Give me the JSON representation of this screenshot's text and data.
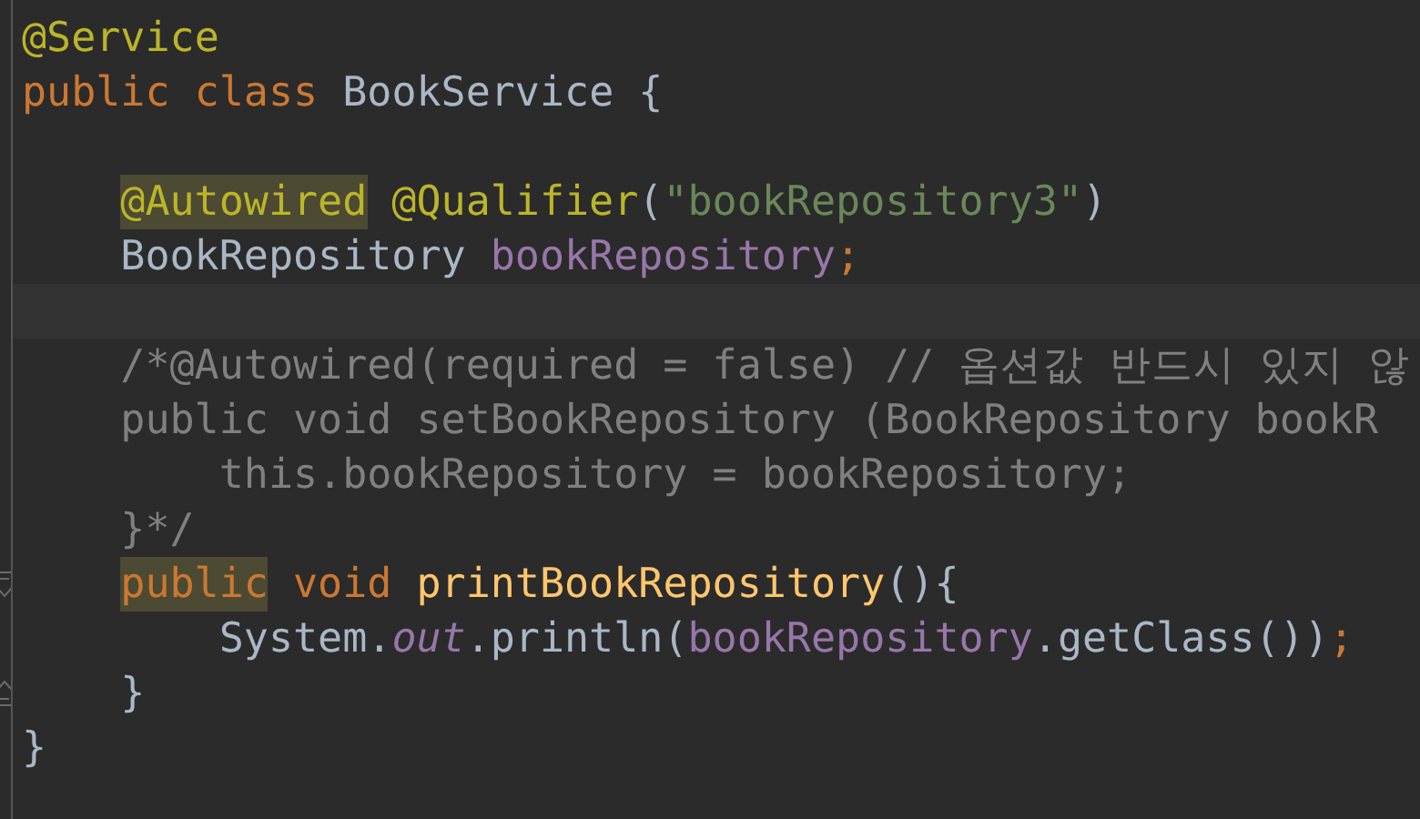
{
  "editor": {
    "lines": [
      {
        "kind": "code",
        "tokens": [
          {
            "kind": "annotation",
            "text": "@Service"
          }
        ]
      },
      {
        "kind": "code",
        "tokens": [
          {
            "kind": "keyword",
            "text": "public class "
          },
          {
            "kind": "plain",
            "text": "BookService {"
          }
        ],
        "children": [
          {
            "kind": "blank"
          },
          {
            "kind": "code",
            "tokens": [
              {
                "kind": "annotation",
                "text": "@Autowired",
                "highlighted": true
              },
              {
                "kind": "annotation",
                "text": " @Qualifier"
              },
              {
                "kind": "plain",
                "text": "("
              },
              {
                "kind": "string",
                "text": "\"bookRepository3\""
              },
              {
                "kind": "plain",
                "text": ")"
              }
            ]
          },
          {
            "kind": "code",
            "tokens": [
              {
                "kind": "plain",
                "text": "BookRepository "
              },
              {
                "kind": "field",
                "text": "bookRepository"
              },
              {
                "kind": "keyword",
                "text": ";"
              }
            ]
          },
          {
            "kind": "blank",
            "current": true
          },
          {
            "kind": "code",
            "tokens": [
              {
                "kind": "comment",
                "text": "/*@Autowired(required = false) // 옵션값 반드시 있지 않"
              }
            ]
          },
          {
            "kind": "code",
            "tokens": [
              {
                "kind": "comment",
                "text": "public void setBookRepository (BookRepository bookR"
              }
            ]
          },
          {
            "kind": "code",
            "tokens": [
              {
                "kind": "comment",
                "text": "    this.bookRepository = bookRepository;"
              }
            ]
          },
          {
            "kind": "code",
            "tokens": [
              {
                "kind": "comment",
                "text": "}*/"
              }
            ]
          },
          {
            "kind": "code",
            "expanded": true,
            "tokens": [
              {
                "kind": "keyword",
                "text": "public",
                "highlighted": true
              },
              {
                "kind": "keyword",
                "text": " void "
              },
              {
                "kind": "method",
                "text": "printBookRepository"
              },
              {
                "kind": "plain",
                "text": "(){"
              }
            ],
            "children": [
              {
                "kind": "code",
                "tokens": [
                  {
                    "kind": "plain",
                    "text": "System."
                  },
                  {
                    "kind": "static",
                    "text": "out"
                  },
                  {
                    "kind": "plain",
                    "text": ".println("
                  },
                  {
                    "kind": "field",
                    "text": "bookRepository"
                  },
                  {
                    "kind": "plain",
                    "text": ".getClass())"
                  },
                  {
                    "kind": "keyword",
                    "text": ";"
                  }
                ]
              }
            ]
          },
          {
            "kind": "code",
            "tokens": [
              {
                "kind": "plain",
                "text": "}"
              }
            ]
          }
        ]
      },
      {
        "kind": "code",
        "tokens": [
          {
            "kind": "plain",
            "text": "}"
          }
        ]
      }
    ]
  }
}
